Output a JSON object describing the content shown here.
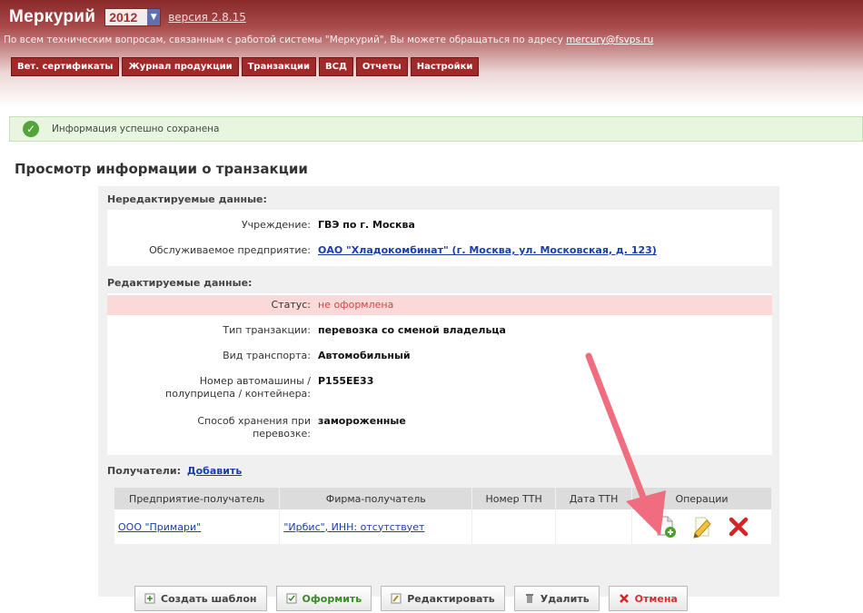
{
  "header": {
    "title": "Меркурий",
    "year": "2012",
    "version_link": "версия 2.8.15",
    "support_text": "По всем техническим вопросам, связанным с работой системы \"Меркурий\", Вы можете обращаться по адресу",
    "support_email": "mercury@fsvps.ru",
    "tabs": [
      {
        "label": "Вет. сертификаты"
      },
      {
        "label": "Журнал продукции"
      },
      {
        "label": "Транзакции"
      },
      {
        "label": "ВСД"
      },
      {
        "label": "Отчеты"
      },
      {
        "label": "Настройки"
      }
    ]
  },
  "message": {
    "text": "Информация успешно сохранена"
  },
  "page": {
    "title": "Просмотр информации о транзакции"
  },
  "readonly": {
    "title": "Нередактируемые данные:",
    "institution": {
      "label": "Учреждение:",
      "value": "ГВЭ по г. Москва"
    },
    "enterprise": {
      "label": "Обслуживаемое предприятие:",
      "value": "ОАО \"Хладокомбинат\" (г. Москва, ул. Московская, д. 123)"
    }
  },
  "editable": {
    "title": "Редактируемые данные:",
    "status": {
      "label": "Статус:",
      "value": "не оформлена"
    },
    "type": {
      "label": "Тип транзакции:",
      "value": "перевозка со сменой владельца"
    },
    "transport": {
      "label": "Вид транспорта:",
      "value": "Автомобильный"
    },
    "vehicle": {
      "label_line1": "Номер автомашины /",
      "label_line2": "полуприцепа / контейнера:",
      "value": "Р155ЕЕ33"
    },
    "storage": {
      "label_line1": "Способ хранения при",
      "label_line2": "перевозке:",
      "value": "замороженные"
    }
  },
  "recipients": {
    "title": "Получатели:",
    "add_link": "Добавить",
    "columns": [
      "Предприятие-получатель",
      "Фирма-получатель",
      "Номер ТТН",
      "Дата ТТН",
      "Операции"
    ],
    "rows": [
      {
        "enterprise": "ООО \"Примари\"",
        "firm": "\"Ирбис\", ИНН: отсутствует",
        "ttn_number": "",
        "ttn_date": ""
      }
    ]
  },
  "buttons": {
    "create_template": "Создать шаблон",
    "issue": "Оформить",
    "edit": "Редактировать",
    "delete": "Удалить",
    "cancel": "Отмена"
  },
  "colors": {
    "brand": "#a02a2a",
    "success_bg": "#e8f6df",
    "status_bg": "#fbd9d9",
    "link": "#1a3fa8",
    "annotation_arrow": "#f06d7f"
  }
}
